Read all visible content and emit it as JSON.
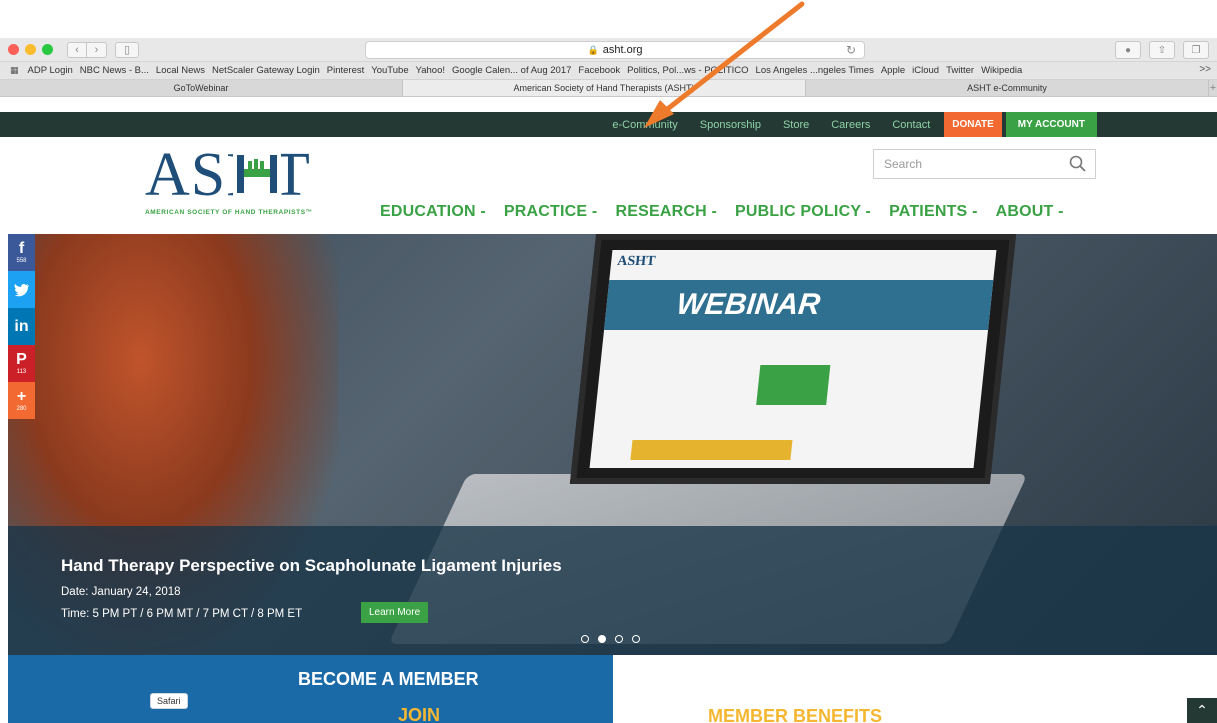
{
  "browser": {
    "url": "asht.org",
    "traffic_light_colors": [
      "#fb5f57",
      "#fdbc2e",
      "#28c840"
    ],
    "bookmarks": [
      "ADP Login",
      "NBC News - B...",
      "Local News",
      "NetScaler Gateway Login",
      "Pinterest",
      "YouTube",
      "Yahoo!",
      "Google Calen... of Aug 2017",
      "Facebook",
      "Politics, Pol...ws - POLITICO",
      "Los Angeles ...ngeles Times",
      "Apple",
      "iCloud",
      "Twitter",
      "Wikipedia"
    ],
    "bookmarks_more": ">>",
    "tabs": [
      {
        "label": "GoToWebinar"
      },
      {
        "label": "American Society of Hand Therapists (ASHT)"
      },
      {
        "label": "ASHT e-Community"
      }
    ],
    "new_tab": "+"
  },
  "site": {
    "colors": {
      "green": "#3aa244",
      "navy": "#1f4e78",
      "topbar": "#243834",
      "orange": "#f26a32",
      "gold": "#f5b731"
    },
    "topnav": {
      "links": [
        "e-Community",
        "Sponsorship",
        "Store",
        "Careers",
        "Contact"
      ],
      "donate": "DONATE",
      "account": "MY ACCOUNT"
    },
    "logo": {
      "letters": "ASHT",
      "tagline": "AMERICAN SOCIETY OF HAND THERAPISTS™"
    },
    "search": {
      "placeholder": "Search"
    },
    "mainnav": [
      "EDUCATION -",
      "PRACTICE -",
      "RESEARCH -",
      "PUBLIC POLICY -",
      "PATIENTS -",
      "ABOUT -"
    ],
    "share": [
      {
        "glyph": "f",
        "count": "558",
        "color": "#3b5998"
      },
      {
        "glyph": "🐦",
        "count": "",
        "color": "#1da1f2"
      },
      {
        "glyph": "in",
        "count": "",
        "color": "#0077b5"
      },
      {
        "glyph": "P",
        "count": "113",
        "color": "#cb2027"
      },
      {
        "glyph": "+",
        "count": "280",
        "color": "#f26a32"
      }
    ],
    "hero": {
      "screen_brand": "ASHT",
      "screen_banner": "WEBINAR",
      "title": "Hand Therapy Perspective on Scapholunate Ligament Injuries",
      "date": "Date: January 24, 2018",
      "time": "Time: 5 PM PT / 6 PM MT / 7 PM CT / 8 PM ET",
      "cta": "Learn More",
      "active_slide": 2,
      "slide_count": 4
    },
    "member": {
      "title": "BECOME A MEMBER",
      "join": "JOIN",
      "tooltip": "Safari"
    },
    "benefits": "MEMBER BENEFITS",
    "scroll_top": "⌃"
  }
}
